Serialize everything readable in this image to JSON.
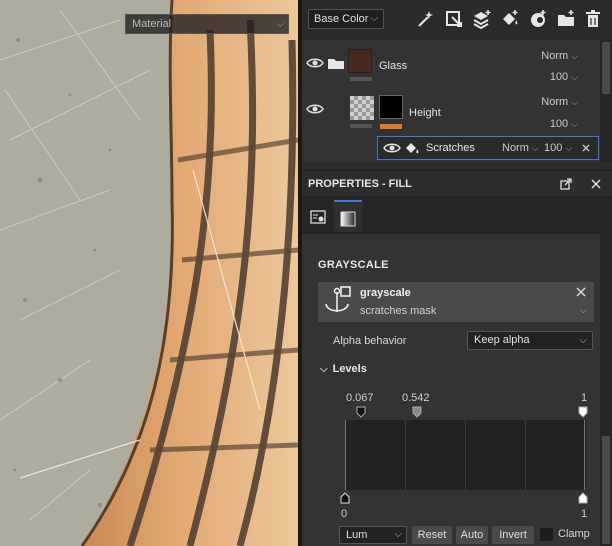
{
  "viewport": {
    "channel_select": "Material"
  },
  "layer_toolbar": {
    "channel": "Base Color",
    "icons": [
      "magic-wand-icon",
      "add-effect-icon",
      "add-layer-icon",
      "fill-layer-icon",
      "mask-icon",
      "add-folder-icon",
      "delete-icon"
    ]
  },
  "layers": [
    {
      "name": "Glass",
      "blend": "Norm",
      "opacity": "100",
      "type": "folder",
      "thumb_color": "#4a2a1e",
      "bar_color": "#555555"
    },
    {
      "name": "Height",
      "blend": "Norm",
      "opacity": "100",
      "type": "layer",
      "bar_color": "#e07a2a"
    },
    {
      "name": "Scratches",
      "blend": "Norm",
      "opacity": "100",
      "type": "fill-effect"
    }
  ],
  "properties": {
    "title": "PROPERTIES - FILL",
    "section": "GRAYSCALE",
    "resource": {
      "name": "grayscale",
      "subtitle": "scratches mask"
    },
    "alpha_behavior": {
      "label": "Alpha behavior",
      "value": "Keep alpha"
    },
    "levels": {
      "label": "Levels",
      "top_left": "0.067",
      "top_mid": "0.542",
      "top_right": "1",
      "bottom_left": "0",
      "bottom_right": "1"
    },
    "bottom_bar": {
      "mode": "Lum",
      "reset": "Reset",
      "auto": "Auto",
      "invert": "Invert",
      "clamp": "Clamp"
    }
  },
  "colors": {
    "accent": "#3d7bd6",
    "height_bar": "#e07a2a",
    "panel_bg": "#2d2d2d"
  }
}
